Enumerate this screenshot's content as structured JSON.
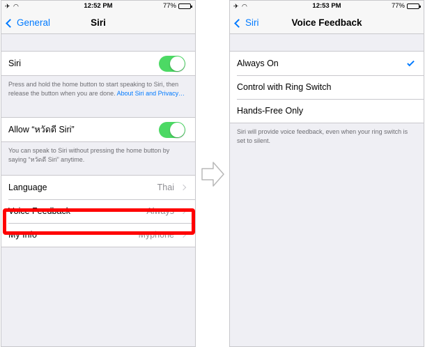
{
  "left_screen": {
    "status": {
      "carrier": "✈ ◠",
      "time": "12:52 PM",
      "battery": "77%",
      "battery_level": 0.77
    },
    "nav": {
      "back": "General",
      "title": "Siri"
    },
    "siri_row": {
      "label": "Siri",
      "toggle": true
    },
    "siri_footer": {
      "text": "Press and hold the home button to start speaking to Siri, then release the button when you are done. ",
      "link": "About Siri and Privacy…"
    },
    "allow_row": {
      "label": "Allow “หวัดดี Siri”",
      "toggle": true
    },
    "allow_footer": "You can speak to Siri without pressing the home button by saying “หวัดดี Siri” anytime.",
    "rows": [
      {
        "label": "Language",
        "value": "Thai"
      },
      {
        "label": "Voice Feedback",
        "value": "Always"
      },
      {
        "label": "My Info",
        "value": "Myphone"
      }
    ]
  },
  "right_screen": {
    "status": {
      "carrier": "✈ ◠",
      "time": "12:53 PM",
      "battery": "77%",
      "battery_level": 0.77
    },
    "nav": {
      "back": "Siri",
      "title": "Voice Feedback"
    },
    "options": [
      {
        "label": "Always On",
        "selected": true
      },
      {
        "label": "Control with Ring Switch",
        "selected": false
      },
      {
        "label": "Hands-Free Only",
        "selected": false
      }
    ],
    "footer": "Siri will provide voice feedback, even when your ring switch is set to silent."
  },
  "colors": {
    "accent": "#007aff",
    "toggle_on": "#4cd964",
    "highlight": "#ff0000",
    "background": "#efeff4"
  },
  "icons": [
    "airplane-icon",
    "wifi-icon",
    "battery-icon",
    "chevron-left-icon",
    "chevron-right-icon",
    "checkmark-icon",
    "arrow-right-icon"
  ]
}
